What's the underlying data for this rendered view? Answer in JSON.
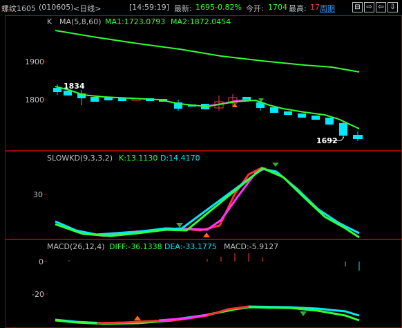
{
  "titlebar": {
    "symbol": "螺纹1605",
    "code": "(010605)",
    "period": "<日线>",
    "time": "[14:59:19]",
    "latest_label": "最新:",
    "latest_value": "1695",
    "change": "-0.82%",
    "open_label": "今开:",
    "open_value": "1704",
    "high_label": "最高:",
    "high_value": "17",
    "cycle_link": "周期",
    "nav": [
      "⊟",
      "⇨",
      "⇦",
      "⇩"
    ]
  },
  "main_panel": {
    "indicator": "K",
    "ma_label": "MA(5,8,60)",
    "ma1": "MA1:1723.0793",
    "ma2": "MA2:1872.0454",
    "y_ticks": [
      "1900",
      "1800"
    ],
    "annotation_high": "1834",
    "annotation_low": "1692"
  },
  "kd_panel": {
    "label": "SLOWKD(9,3,3,2)",
    "k": "K:13.1130",
    "d": "D:14.4170",
    "y_ticks": [
      "30"
    ]
  },
  "macd_panel": {
    "label": "MACD(26,12,4)",
    "diff": "DIFF:-36.1338",
    "dea": "DEA:-33.1775",
    "macd": "MACD:-5.9127",
    "y_ticks": [
      "0",
      "-20"
    ]
  },
  "colors": {
    "up": "#ff3b3b",
    "down": "#00e8ff",
    "ma_line": "#33ff33",
    "magenta": "#ff33ff",
    "border": "#a00000",
    "text": "#c0c0c0",
    "highlight_blue": "#3399ff"
  }
}
